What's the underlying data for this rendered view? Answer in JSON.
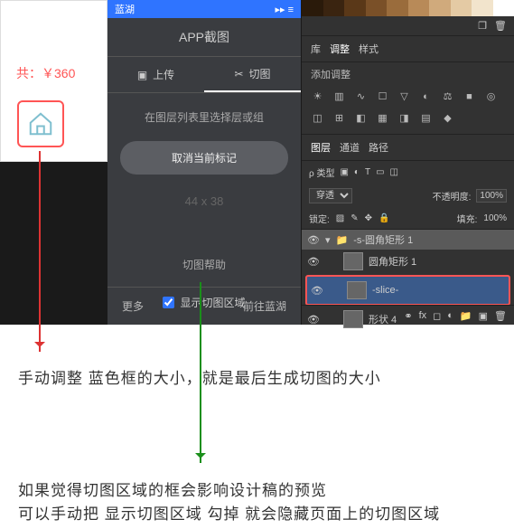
{
  "canvas": {
    "price": "共：￥360",
    "home_label": "首页"
  },
  "lanhu": {
    "brand": "蓝湖",
    "title": "APP截图",
    "tab_upload": "上传",
    "tab_slice": "切图",
    "hint": "在图层列表里选择层或组",
    "cancel": "取消当前标记",
    "dim_w": "44",
    "dim_x": "x",
    "dim_h": "38",
    "help": "切图帮助",
    "show_area": "显示切图区域",
    "more": "更多",
    "goto": "前往蓝湖"
  },
  "ps": {
    "tabs": {
      "lib": "库",
      "adjust": "调整",
      "style": "样式"
    },
    "add_adjust": "添加调整",
    "layer_tabs": {
      "layers": "图层",
      "channels": "通道",
      "paths": "路径"
    },
    "kind": "ρ 类型",
    "blend": "穿透",
    "opacity_label": "不透明度:",
    "opacity_val": "100%",
    "lock_label": "锁定:",
    "fill_label": "填充:",
    "fill_val": "100%",
    "layers": {
      "group1": "-s-圆角矩形 1",
      "rect1": "圆角矩形 1",
      "slice": "-slice-",
      "shape4": "形状 4"
    }
  },
  "notes": {
    "n1": "手动调整 蓝色框的大小，就是最后生成切图的大小",
    "n2": "如果觉得切图区域的框会影响设计稿的预览",
    "n3": "可以手动把 显示切图区域 勾掉 就会隐藏页面上的切图区域"
  }
}
